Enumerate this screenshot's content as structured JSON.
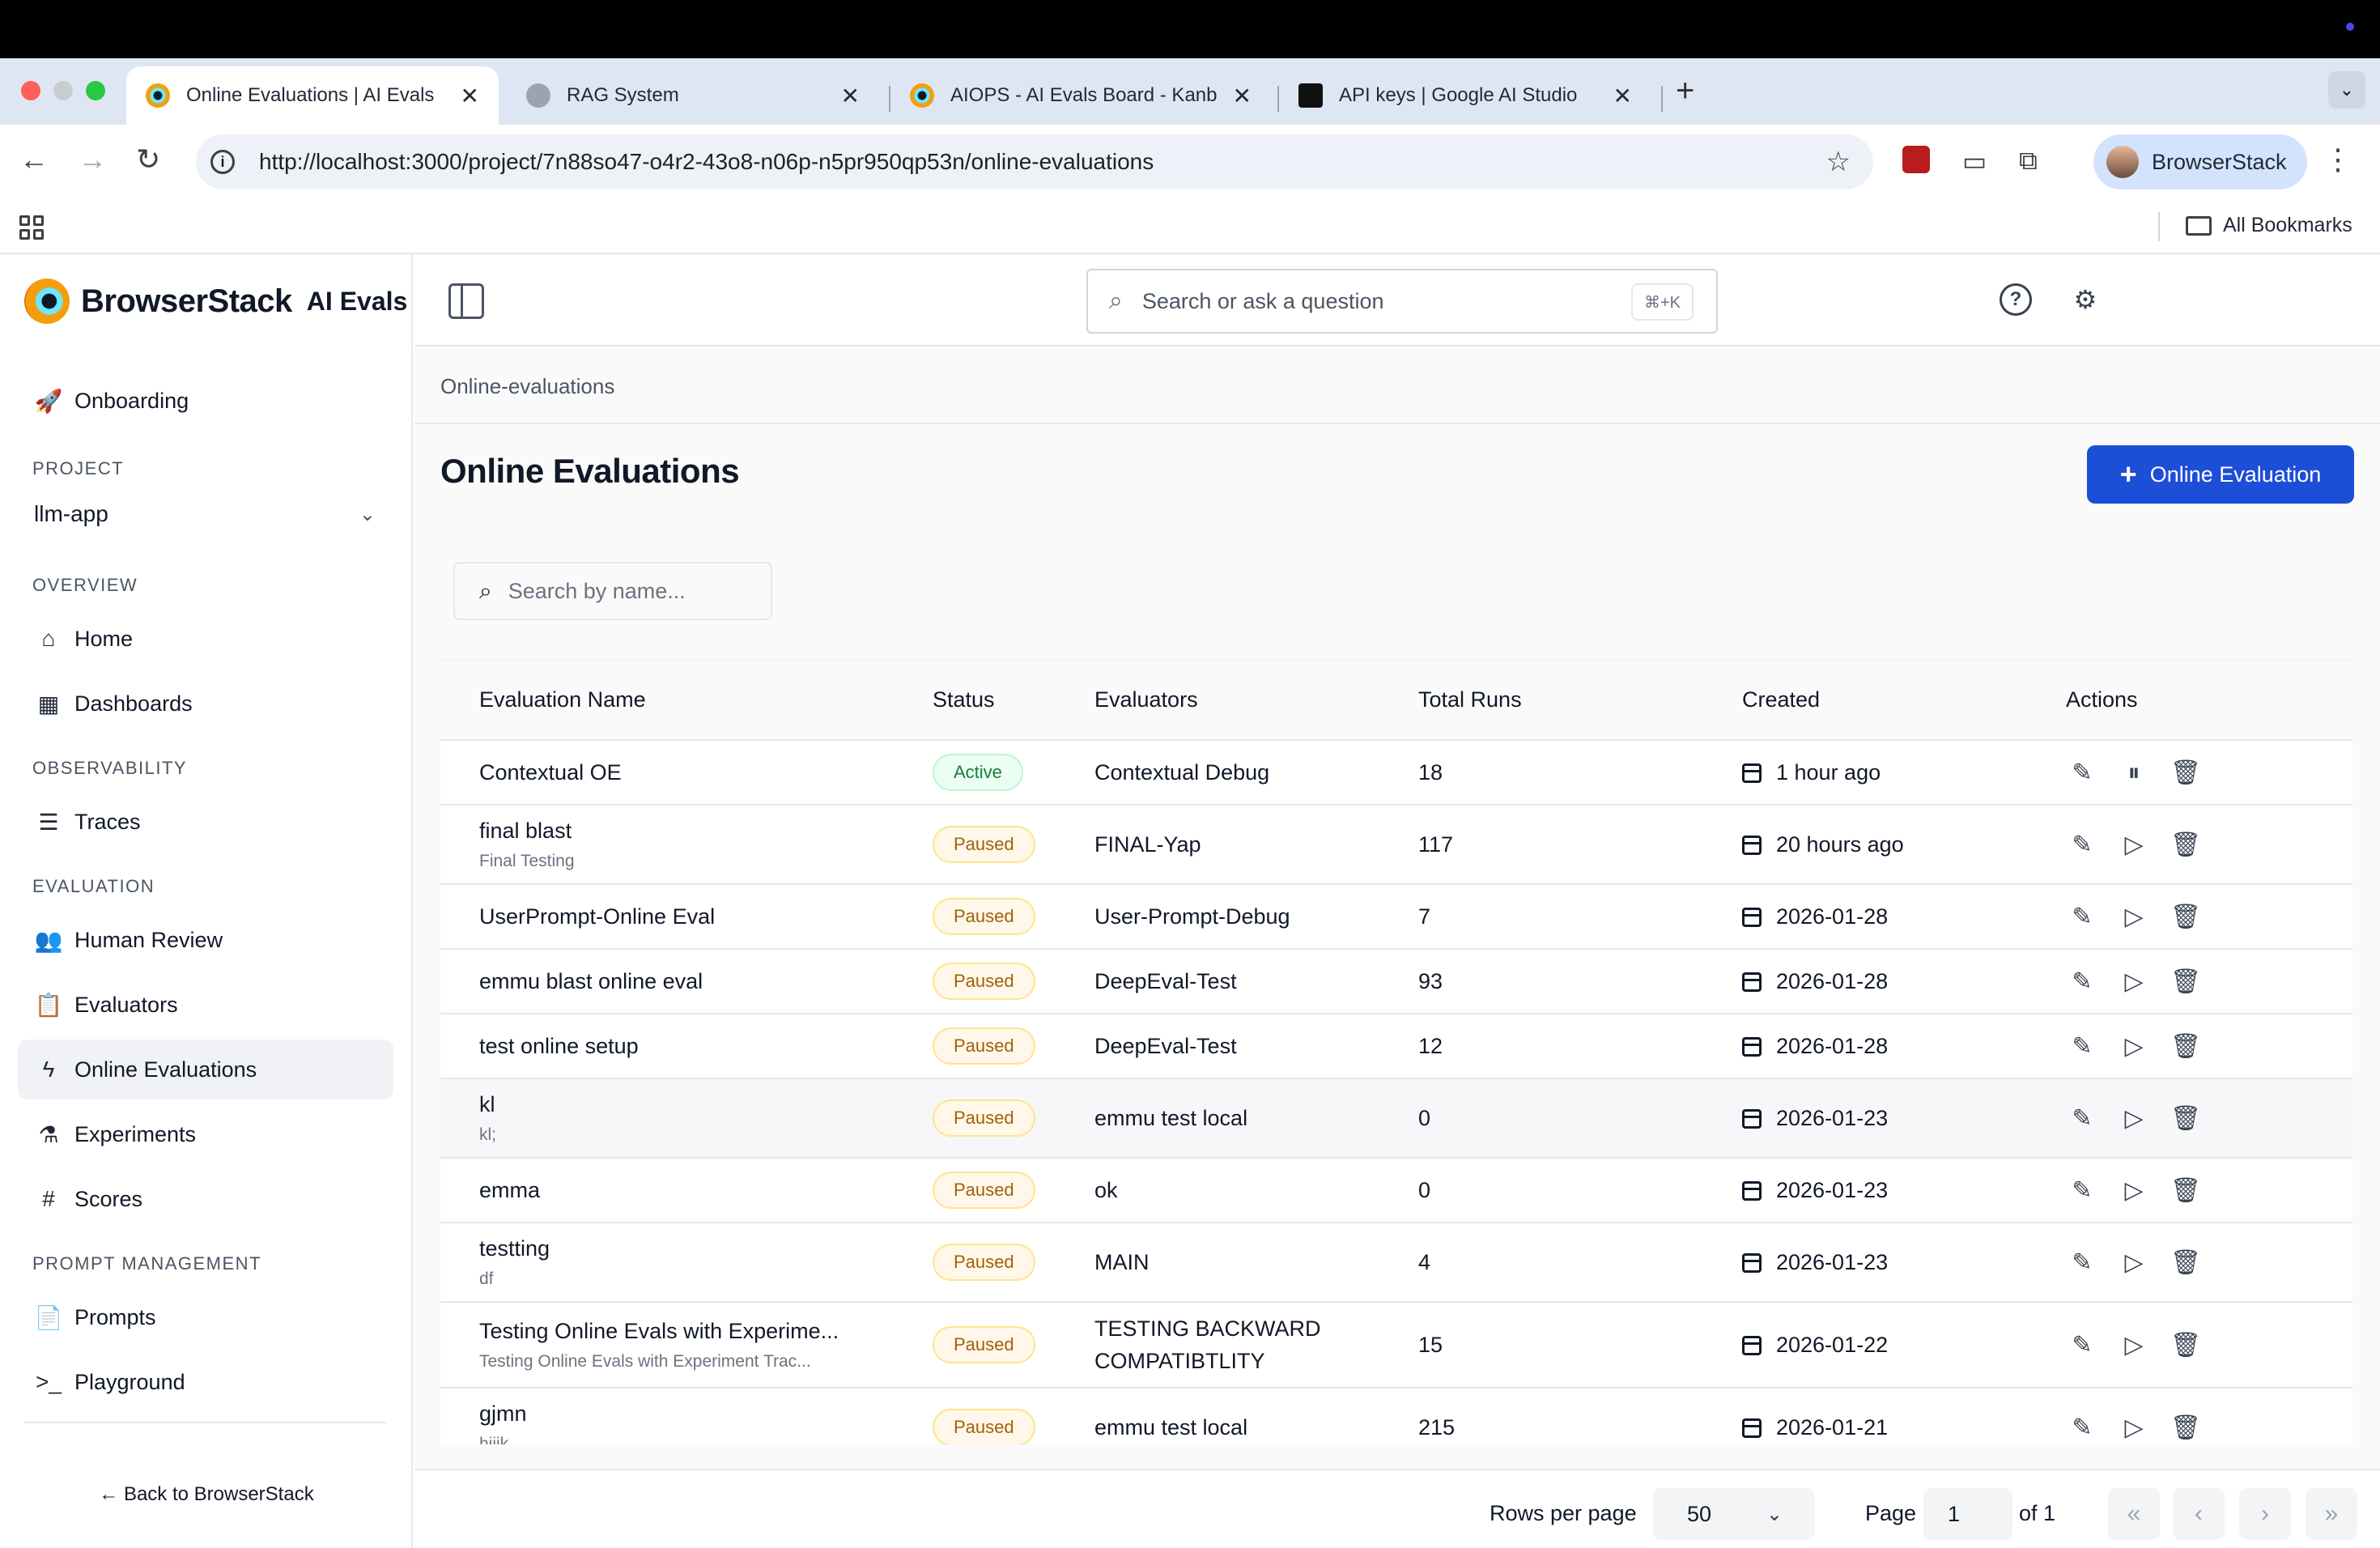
{
  "browser": {
    "tabs": [
      {
        "title": "Online Evaluations | AI Evals",
        "active": true
      },
      {
        "title": "RAG System",
        "active": false
      },
      {
        "title": "AIOPS - AI Evals Board - Kanb",
        "active": false
      },
      {
        "title": "API keys | Google AI Studio",
        "active": false
      }
    ],
    "close_glyph": "✕",
    "new_tab_glyph": "+",
    "url": "http://localhost:3000/project/7n88so47-o4r2-43o8-n06p-n5pr950qp53n/online-evaluations",
    "profile_name": "BrowserStack",
    "bookmarks_label": "All Bookmarks"
  },
  "sidebar": {
    "brand_name": "BrowserStack",
    "brand_sub": "AI Evals",
    "onboarding": "Onboarding",
    "project_label": "PROJECT",
    "project_value": "llm-app",
    "overview_label": "OVERVIEW",
    "home": "Home",
    "dashboards": "Dashboards",
    "observability_label": "OBSERVABILITY",
    "traces": "Traces",
    "evaluation_label": "EVALUATION",
    "human_review": "Human Review",
    "evaluators": "Evaluators",
    "online_evaluations": "Online Evaluations",
    "experiments": "Experiments",
    "scores": "Scores",
    "prompt_management_label": "PROMPT MANAGEMENT",
    "prompts": "Prompts",
    "playground": "Playground",
    "back_link": "← Back to BrowserStack"
  },
  "topbar": {
    "search_placeholder": "Search or ask a question",
    "search_shortcut": "⌘+K"
  },
  "page": {
    "breadcrumb": "Online-evaluations",
    "title": "Online Evaluations",
    "new_button": "Online Evaluation",
    "search_placeholder": "Search by name..."
  },
  "table": {
    "headers": [
      "Evaluation Name",
      "Status",
      "Evaluators",
      "Total Runs",
      "Created",
      "Actions"
    ],
    "rows": [
      {
        "name": "Contextual OE",
        "desc": "",
        "status": "Active",
        "evaluators": "Contextual Debug",
        "runs": "18",
        "created": "1 hour ago"
      },
      {
        "name": "final blast",
        "desc": "Final Testing",
        "status": "Paused",
        "evaluators": "FINAL-Yap",
        "runs": "117",
        "created": "20 hours ago"
      },
      {
        "name": "UserPrompt-Online Eval",
        "desc": "",
        "status": "Paused",
        "evaluators": "User-Prompt-Debug",
        "runs": "7",
        "created": "2026-01-28"
      },
      {
        "name": "emmu blast online eval",
        "desc": "",
        "status": "Paused",
        "evaluators": "DeepEval-Test",
        "runs": "93",
        "created": "2026-01-28"
      },
      {
        "name": "test online setup",
        "desc": "",
        "status": "Paused",
        "evaluators": "DeepEval-Test",
        "runs": "12",
        "created": "2026-01-28"
      },
      {
        "name": "kl",
        "desc": "kl;",
        "status": "Paused",
        "evaluators": "emmu test local",
        "runs": "0",
        "created": "2026-01-23"
      },
      {
        "name": "emma",
        "desc": "",
        "status": "Paused",
        "evaluators": "ok",
        "runs": "0",
        "created": "2026-01-23"
      },
      {
        "name": "testting",
        "desc": "df",
        "status": "Paused",
        "evaluators": "MAIN",
        "runs": "4",
        "created": "2026-01-23"
      },
      {
        "name": "Testing Online Evals with Experime...",
        "desc": "Testing Online Evals with Experiment Trac...",
        "status": "Paused",
        "evaluators": "TESTING BACKWARD COMPATIBTLITY",
        "runs": "15",
        "created": "2026-01-22"
      },
      {
        "name": "gjmn",
        "desc": "hjijk",
        "status": "Paused",
        "evaluators": "emmu test local",
        "runs": "215",
        "created": "2026-01-21"
      }
    ]
  },
  "pagination": {
    "rows_per_page_label": "Rows per page",
    "rows_per_page_value": "50",
    "page_label": "Page",
    "page_value": "1",
    "of_label": "of 1"
  }
}
